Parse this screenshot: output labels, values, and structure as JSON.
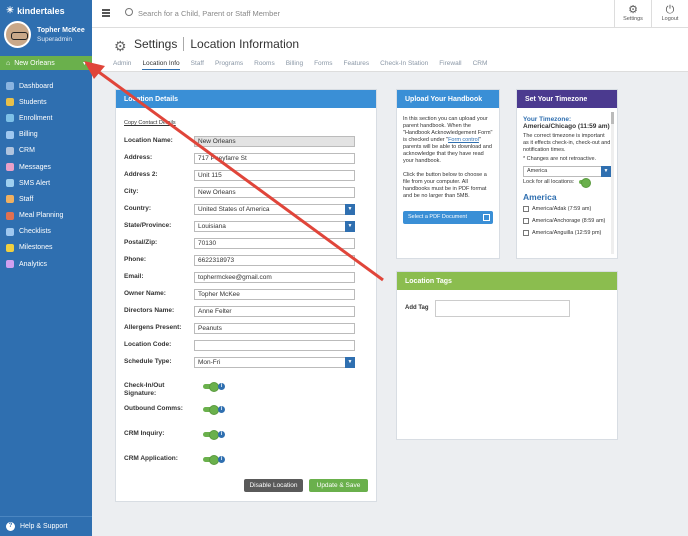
{
  "brand": {
    "logo": "kindertales"
  },
  "user": {
    "name": "Topher McKee",
    "role": "Superadmin"
  },
  "location_selector": {
    "label": "New Orleans"
  },
  "nav": [
    {
      "label": "Dashboard",
      "icon": "dashboard-icon",
      "color": "#8ab4e0"
    },
    {
      "label": "Students",
      "icon": "students-icon",
      "color": "#e8c04a"
    },
    {
      "label": "Enrollment",
      "icon": "enrollment-icon",
      "color": "#7ec1e8"
    },
    {
      "label": "Billing",
      "icon": "billing-icon",
      "color": "#9fc8f0"
    },
    {
      "label": "CRM",
      "icon": "crm-icon",
      "color": "#b0c4de"
    },
    {
      "label": "Messages",
      "icon": "messages-icon",
      "color": "#e9a0c8"
    },
    {
      "label": "SMS Alert",
      "icon": "sms-icon",
      "color": "#9fd0f0"
    },
    {
      "label": "Staff",
      "icon": "staff-icon",
      "color": "#f0b060"
    },
    {
      "label": "Meal Planning",
      "icon": "meal-icon",
      "color": "#e07050"
    },
    {
      "label": "Checklists",
      "icon": "checklist-icon",
      "color": "#9fc8f0"
    },
    {
      "label": "Milestones",
      "icon": "milestones-icon",
      "color": "#f0d040"
    },
    {
      "label": "Analytics",
      "icon": "analytics-icon",
      "color": "#d0a0f0"
    }
  ],
  "help": {
    "label": "Help & Support"
  },
  "search": {
    "placeholder": "Search for a Child, Parent or Staff Member"
  },
  "topbar": {
    "settings": "Settings",
    "logout": "Logout"
  },
  "header": {
    "title": "Settings",
    "subtitle": "Location Information"
  },
  "tabs": [
    "Admin",
    "Location Info",
    "Staff",
    "Programs",
    "Rooms",
    "Billing",
    "Forms",
    "Features",
    "Check-In Station",
    "Firewall",
    "CRM"
  ],
  "details": {
    "title": "Location Details",
    "copy_link": "Copy Contact Details",
    "fields": [
      {
        "label": "Location Name:",
        "value": "New Orleans"
      },
      {
        "label": "Address:",
        "value": "717 Poeyfarre St"
      },
      {
        "label": "Address 2:",
        "value": "Unit 115"
      },
      {
        "label": "City:",
        "value": "New Orleans"
      },
      {
        "label": "Country:",
        "value": "United States of America"
      },
      {
        "label": "State/Province:",
        "value": "Louisiana"
      },
      {
        "label": "Postal/Zip:",
        "value": "70130"
      },
      {
        "label": "Phone:",
        "value": "6622318973"
      },
      {
        "label": "Email:",
        "value": "tophermckee@gmail.com"
      },
      {
        "label": "Owner Name:",
        "value": "Topher McKee"
      },
      {
        "label": "Directors Name:",
        "value": "Anne Felter"
      },
      {
        "label": "Allergens Present:",
        "value": "Peanuts"
      },
      {
        "label": "Location Code:",
        "value": ""
      },
      {
        "label": "Schedule Type:",
        "value": "Mon-Fri"
      }
    ],
    "toggles": [
      {
        "label": "Check-In/Out Signature:",
        "on": true
      },
      {
        "label": "Outbound Comms:",
        "on": true
      },
      {
        "label": "CRM Inquiry:",
        "on": true
      },
      {
        "label": "CRM Application:",
        "on": true
      }
    ],
    "disable_button": "Disable Location",
    "save_button": "Update & Save"
  },
  "handbook": {
    "title": "Upload Your Handbook",
    "text_pre": "In this section you can upload your parent handbook. When the \"Handbook Acknowledgement Form\" is checked under \"",
    "link": "Form control",
    "text_post": "\" parents will be able to download and acknowledge that they have read your handbook.",
    "text2": "Click the button below to choose a file from your computer. All handbooks must be in PDF format and be no larger than 5MB.",
    "button": "Select a PDF Document"
  },
  "timezone": {
    "title": "Set Your Timezone",
    "current_label": "Your Timezone:",
    "current_value": "America/Chicago (11:59 am)",
    "note": "The correct timezone is important as it effects check-in, check-out and notification times.",
    "warning": "* Changes are not retroactive.",
    "region": "America",
    "lock_label": "Lock for all locations:",
    "region_heading": "America",
    "options": [
      "America/Adak (7:59 am)",
      "America/Anchorage (8:59 am)",
      "America/Anguilla (12:59 pm)"
    ]
  },
  "tags": {
    "title": "Location Tags",
    "add_label": "Add Tag",
    "input_value": ""
  },
  "colors": {
    "sidebar": "#2f6fb0",
    "green": "#6ab04c",
    "blue": "#3a8fd6",
    "purple": "#4b3a8f",
    "gray_btn": "#5a5a5a",
    "arrow": "#e0453a"
  }
}
